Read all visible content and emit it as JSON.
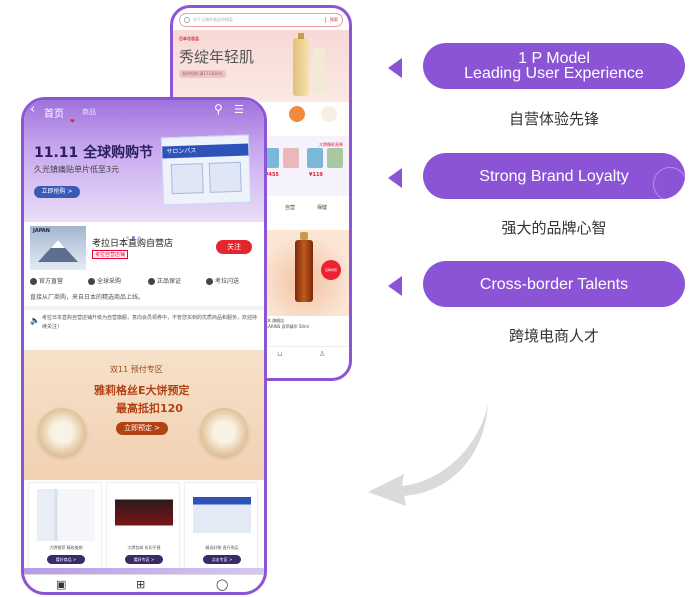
{
  "back_phone": {
    "search_placeholder": "在千万海外商品中搜索",
    "search_button": "搜索",
    "banner_tag": "日本化妆品",
    "banner_title": "秀绽年轻肌",
    "banner_sub": "限时抢购 满171享好礼",
    "promo_header": "大牌爆款直降",
    "price_1": "¥455",
    "price_2": "¥119",
    "tab_1": "自营",
    "tab_2": "保健",
    "badge": "直降特惠",
    "caption_line1": "日本 旗舰店",
    "caption_line2": "CLARINS 双萃精华 50ml",
    "caption_line3": "¥"
  },
  "front_phone": {
    "header_back": "‹",
    "header_home": "首页",
    "header_product": "商品",
    "title": "11.11 全球购购节",
    "subtitle": "久光镇痛贴单片低至3元",
    "banner_button": "立即抢购 >",
    "box_label": "サロンパス",
    "store_logo_text": "JAPAN",
    "store_name": "考拉日本直购自营店",
    "store_tag": "考拉自营店铺",
    "follow_button": "关注",
    "badges": [
      "官方直营",
      "全球采购",
      "正品保证",
      "考拉闪送"
    ],
    "origin_text": "直接从厂商购，来自日本的精选商品上线。",
    "notice_text": "考拉日本直购自营店铺升级为自营旗舰，意向会员领券中，不管您买到的优质商品和服务，欢迎持续关注！",
    "promo_header": "双11 预付专区",
    "promo_line1": "雅莉格丝E大饼预定",
    "promo_line2": "最高抵扣120",
    "promo_cta": "立即预定 >",
    "cards": [
      {
        "caption": "大牌推荐 精致美颜",
        "cta": "看好商品 >"
      },
      {
        "caption": "大牌包邮 折扣平替",
        "cta": "看好专区 >"
      },
      {
        "caption": "精选好物 直升购买",
        "cta": "点击专区 >"
      }
    ]
  },
  "features": [
    {
      "pill_line1": "1 P Model",
      "pill_line2": "Leading User Experience",
      "caption": "自营体验先锋"
    },
    {
      "pill_line1": "Strong Brand Loyalty",
      "pill_line2": "",
      "caption": "强大的品牌心智"
    },
    {
      "pill_line1": "Cross-border Talents",
      "pill_line2": "",
      "caption": "跨境电商人才"
    }
  ],
  "colors": {
    "accent_purple": "#8b54d6",
    "follow_red": "#e3262e",
    "arrow_gray": "#d8d8d8"
  },
  "icons": [
    "back-icon",
    "search-icon",
    "menu-icon",
    "speaker-icon",
    "home-tab-icon",
    "category-tab-icon",
    "cart-tab-icon",
    "curved-arrow-icon",
    "pointer-icon",
    "seal-icon"
  ]
}
